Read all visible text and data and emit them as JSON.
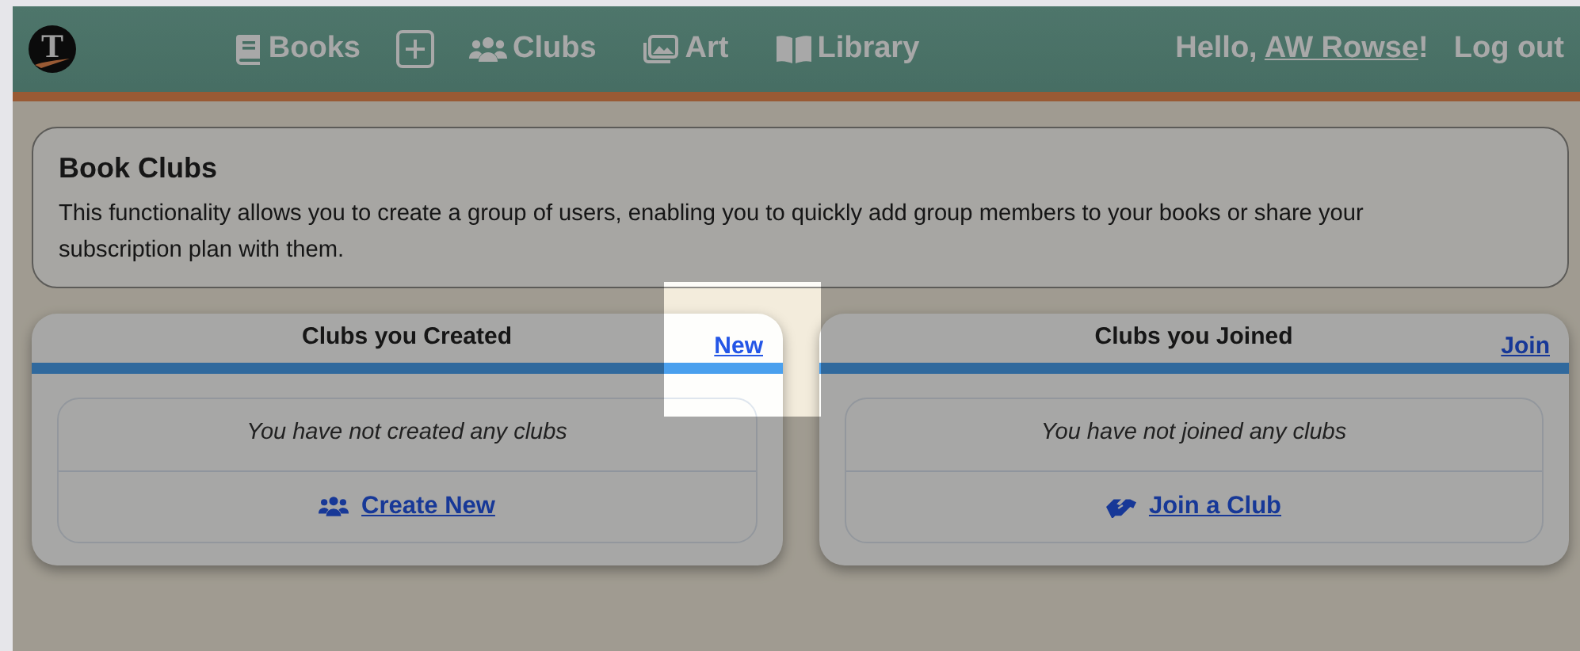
{
  "navbar": {
    "logo": {
      "letter": "T"
    },
    "items": [
      {
        "kind": "books",
        "label": "Books"
      },
      {
        "kind": "add"
      },
      {
        "kind": "clubs",
        "label": "Clubs"
      },
      {
        "kind": "art",
        "label": "Art"
      },
      {
        "kind": "library",
        "label": "Library"
      }
    ],
    "greeting": {
      "prefix": "Hello, ",
      "user": "AW Rowse",
      "suffix": "!"
    },
    "logout": "Log out"
  },
  "intro": {
    "title": "Book Clubs",
    "text": "This functionality allows you to create a group of users, enabling you to quickly add group members to your books or share your subscription plan with them."
  },
  "panels": [
    {
      "title": "Clubs you Created",
      "header_link": "New",
      "highlighted": true,
      "empty_message": "You have not created any clubs",
      "action": {
        "kind": "users",
        "label": "Create New"
      }
    },
    {
      "title": "Clubs you Joined",
      "header_link": "Join",
      "highlighted": false,
      "empty_message": "You have not joined any clubs",
      "action": {
        "kind": "handshake",
        "label": "Join a Club"
      }
    }
  ]
}
